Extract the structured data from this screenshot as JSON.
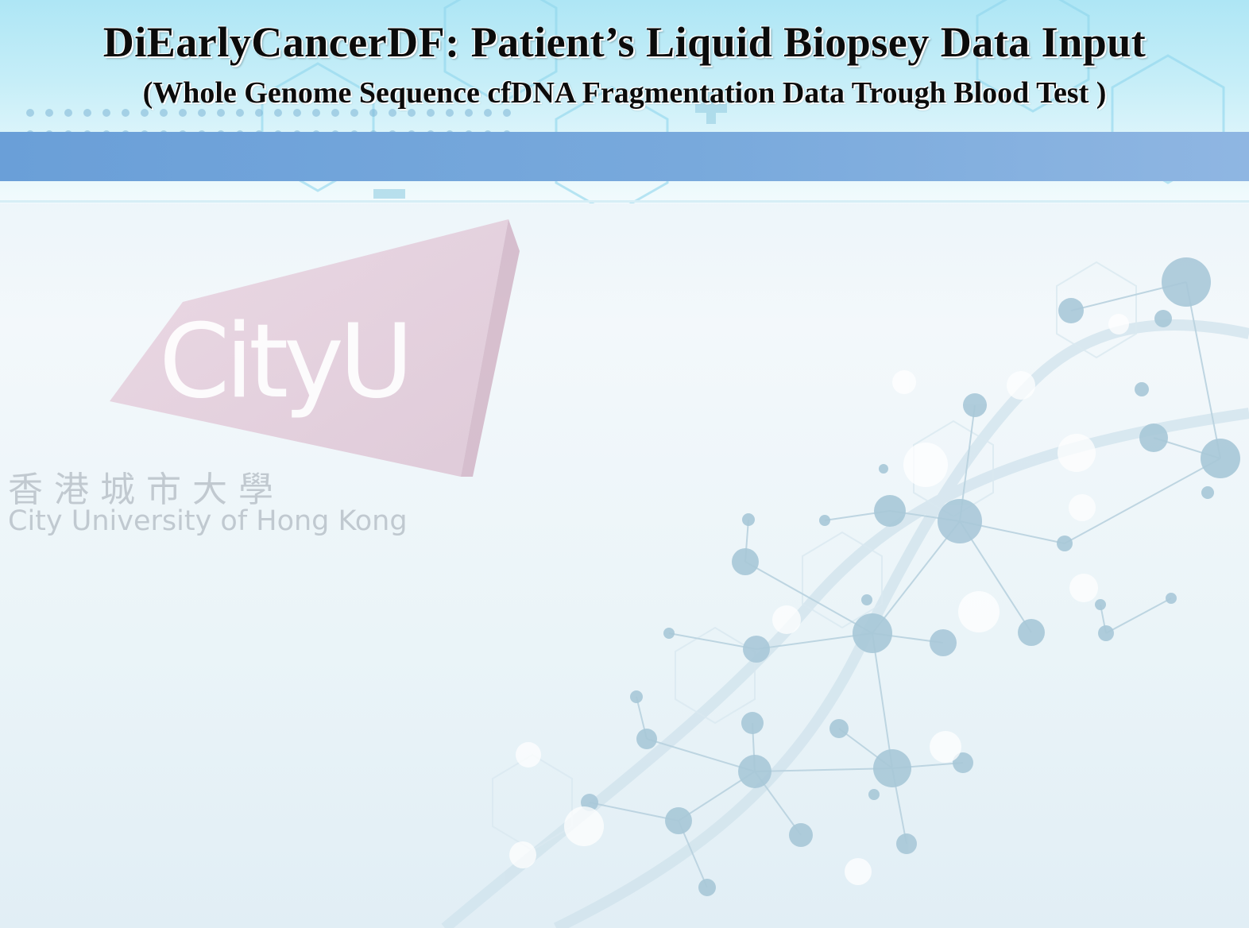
{
  "header": {
    "title": "DiEarlyCancerDF:  Patient’s Liquid Biopsey Data Input",
    "subtitle": "(Whole Genome Sequence cfDNA Fragmentation Data Trough Blood Test )"
  },
  "logo": {
    "wordmark": "CityU",
    "chinese_name": "香港城市大學",
    "english_name": "City University of Hong Kong"
  },
  "colors": {
    "header_top": "#aee6f5",
    "header_band": "#6a9fd8",
    "logo_shape": "#e2c6d6",
    "title_text": "#0b0b0b",
    "molecule": "#a9c9d9"
  },
  "icons": [
    "cityu-logo-icon",
    "dna-molecule-decoration"
  ]
}
